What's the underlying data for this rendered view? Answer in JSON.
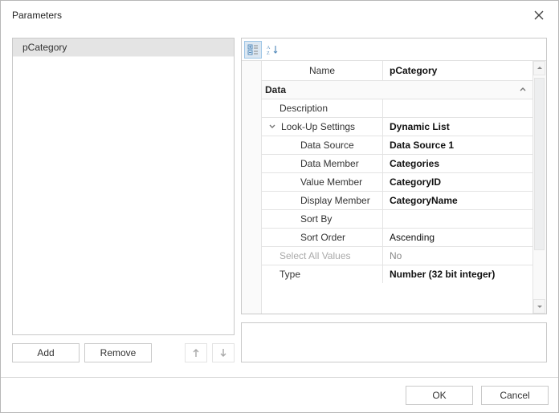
{
  "dialog": {
    "title": "Parameters"
  },
  "list": {
    "items": [
      "pCategory"
    ]
  },
  "buttons": {
    "add": "Add",
    "remove": "Remove",
    "ok": "OK",
    "cancel": "Cancel"
  },
  "grid": {
    "name_label": "Name",
    "name_value": "pCategory",
    "section_data": "Data",
    "rows": {
      "description": {
        "label": "Description",
        "value": ""
      },
      "lookup": {
        "label": "Look-Up Settings",
        "value": "Dynamic List"
      },
      "data_source": {
        "label": "Data Source",
        "value": "Data Source 1"
      },
      "data_member": {
        "label": "Data Member",
        "value": "Categories"
      },
      "value_member": {
        "label": "Value Member",
        "value": "CategoryID"
      },
      "display_member": {
        "label": "Display Member",
        "value": "CategoryName"
      },
      "sort_by": {
        "label": "Sort By",
        "value": ""
      },
      "sort_order": {
        "label": "Sort Order",
        "value": "Ascending"
      },
      "select_all": {
        "label": "Select All Values",
        "value": "No"
      },
      "type": {
        "label": "Type",
        "value": "Number (32 bit integer)"
      }
    }
  }
}
